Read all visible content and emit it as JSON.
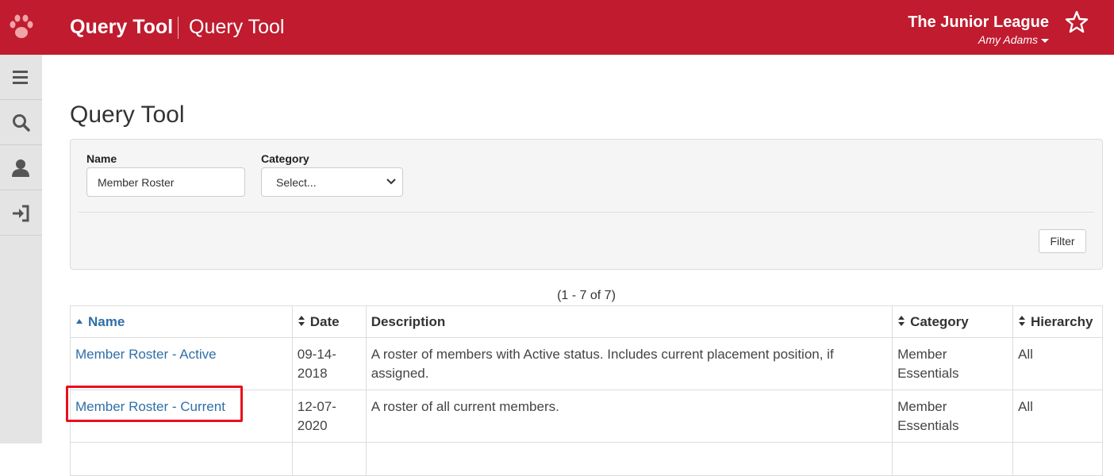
{
  "header": {
    "app_title": "Query Tool",
    "page_heading": "Query Tool",
    "org_name": "The Junior League",
    "user_name": "Amy Adams",
    "brand_color": "#c01b2e"
  },
  "sidebar": {
    "items": [
      {
        "icon": "hamburger-menu-icon"
      },
      {
        "icon": "search-icon"
      },
      {
        "icon": "user-icon"
      },
      {
        "icon": "sign-in-icon"
      }
    ]
  },
  "main": {
    "title": "Query Tool"
  },
  "filters": {
    "name_label": "Name",
    "name_value": "Member Roster",
    "category_label": "Category",
    "category_selected": "Select...",
    "filter_button": "Filter"
  },
  "pager": {
    "text": "(1 - 7 of 7)"
  },
  "table": {
    "columns": [
      "Name",
      "Date",
      "Description",
      "Category",
      "Hierarchy"
    ],
    "rows": [
      {
        "name": "Member Roster - Active",
        "date": "09-14-2018",
        "description": "A roster of members with Active status. Includes current placement position, if assigned.",
        "category": "Member Essentials",
        "hierarchy": "All"
      },
      {
        "name": "Member Roster - Current",
        "date": "12-07-2020",
        "description": "A roster of all current members.",
        "category": "Member Essentials",
        "hierarchy": "All"
      }
    ]
  }
}
